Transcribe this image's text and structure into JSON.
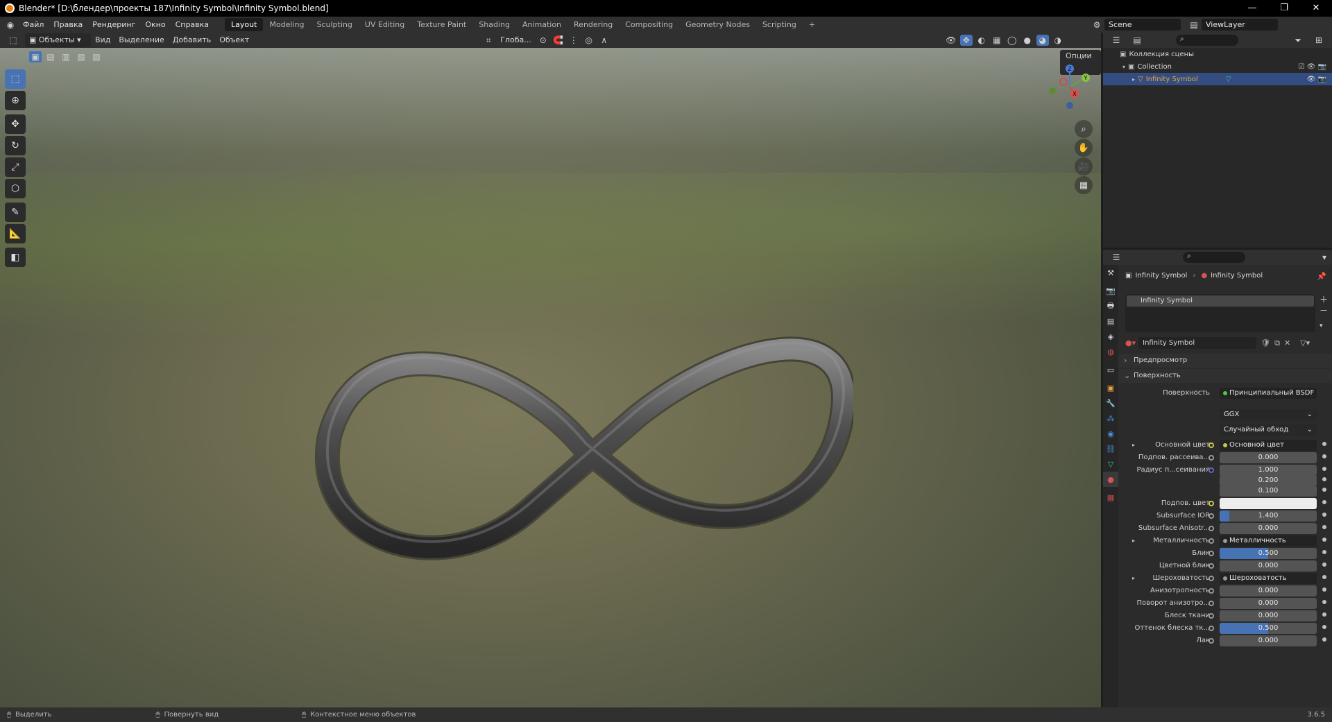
{
  "window": {
    "title": "Blender* [D:\\блендер\\проекты 187\\Infinity Symbol\\Infinity Symbol.blend]",
    "controls": [
      "—",
      "❐",
      "✕"
    ]
  },
  "menu": [
    "Файл",
    "Правка",
    "Рендеринг",
    "Окно",
    "Справка"
  ],
  "workspaces": [
    "Layout",
    "Modeling",
    "Sculpting",
    "UV Editing",
    "Texture Paint",
    "Shading",
    "Animation",
    "Rendering",
    "Compositing",
    "Geometry Nodes",
    "Scripting",
    "+"
  ],
  "scene": {
    "label": "Scene",
    "view_layer": "ViewLayer"
  },
  "viewport_header": {
    "mode": "Объекты",
    "menus": [
      "Вид",
      "Выделение",
      "Добавить",
      "Объект"
    ],
    "transform": "Глоба...",
    "options": "Опции"
  },
  "tools": [
    {
      "icon": "⬚",
      "active": true
    },
    {
      "icon": "⊕",
      "active": false
    },
    {
      "icon": "✥",
      "active": false
    },
    {
      "icon": "↻",
      "active": false
    },
    {
      "icon": "⤢",
      "active": false
    },
    {
      "icon": "⬡",
      "active": false
    },
    {
      "icon": "✎",
      "active": false
    },
    {
      "icon": "📐",
      "active": false
    },
    {
      "icon": "◧",
      "active": false
    }
  ],
  "gizmo": {
    "x": "X",
    "y": "Y",
    "z": "Z"
  },
  "outliner": {
    "scene_collection": "Коллекция сцены",
    "collection": "Collection",
    "object": "Infinity Symbol"
  },
  "properties": {
    "breadcrumb_object": "Infinity Symbol",
    "breadcrumb_material": "Infinity Symbol",
    "slot": "Infinity Symbol",
    "material_name": "Infinity Symbol",
    "sections": {
      "preview": "Предпросмотр",
      "surface": "Поверхность"
    },
    "surface_label": "Поверхность",
    "surface_value": "Принципиальный BSDF",
    "distribution": "GGX",
    "subsurface_method": "Случайный обход",
    "rows": [
      {
        "label": "Основной цвет",
        "value": "Основной цвет",
        "kind": "link",
        "dot": "#c8c84a",
        "expand": true
      },
      {
        "label": "Подпов. рассеива...",
        "value": "0.000",
        "kind": "num",
        "dot": "#9a9a9a"
      },
      {
        "label": "Радиус п...сеивания",
        "value": "1.000",
        "kind": "num",
        "dot": "#6363c7"
      },
      {
        "label": "",
        "value": "0.200",
        "kind": "num",
        "dot": ""
      },
      {
        "label": "",
        "value": "0.100",
        "kind": "num",
        "dot": ""
      },
      {
        "label": "Подпов. цвет",
        "value": "",
        "kind": "color",
        "dot": "#c8c84a"
      },
      {
        "label": "Subsurface IOR",
        "value": "1.400",
        "kind": "num",
        "dot": "#9a9a9a",
        "fill": 0.1
      },
      {
        "label": "Subsurface Anisotr...",
        "value": "0.000",
        "kind": "num",
        "dot": "#9a9a9a"
      },
      {
        "label": "Металличность",
        "value": "Металличность",
        "kind": "link",
        "dot": "#9a9a9a",
        "expand": true
      },
      {
        "label": "Блик",
        "value": "0.500",
        "kind": "num",
        "dot": "#9a9a9a",
        "fill": 0.5
      },
      {
        "label": "Цветной блик",
        "value": "0.000",
        "kind": "num",
        "dot": "#9a9a9a"
      },
      {
        "label": "Шероховатость",
        "value": "Шероховатость",
        "kind": "link",
        "dot": "#9a9a9a",
        "expand": true
      },
      {
        "label": "Анизотропность",
        "value": "0.000",
        "kind": "num",
        "dot": "#9a9a9a"
      },
      {
        "label": "Поворот анизотро...",
        "value": "0.000",
        "kind": "num",
        "dot": "#9a9a9a"
      },
      {
        "label": "Блеск ткани",
        "value": "0.000",
        "kind": "num",
        "dot": "#9a9a9a"
      },
      {
        "label": "Оттенок блеска тк...",
        "value": "0.500",
        "kind": "num",
        "dot": "#9a9a9a",
        "fill": 0.5
      },
      {
        "label": "Лак",
        "value": "0.000",
        "kind": "num",
        "dot": "#9a9a9a"
      }
    ]
  },
  "statusbar": {
    "select": "Выделить",
    "rotate": "Повернуть вид",
    "context": "Контекстное меню объектов",
    "version": "3.6.5"
  },
  "colors": {
    "accent": "#4772b3",
    "selected_row": "#334d80",
    "object_orange": "#e8a33d"
  }
}
